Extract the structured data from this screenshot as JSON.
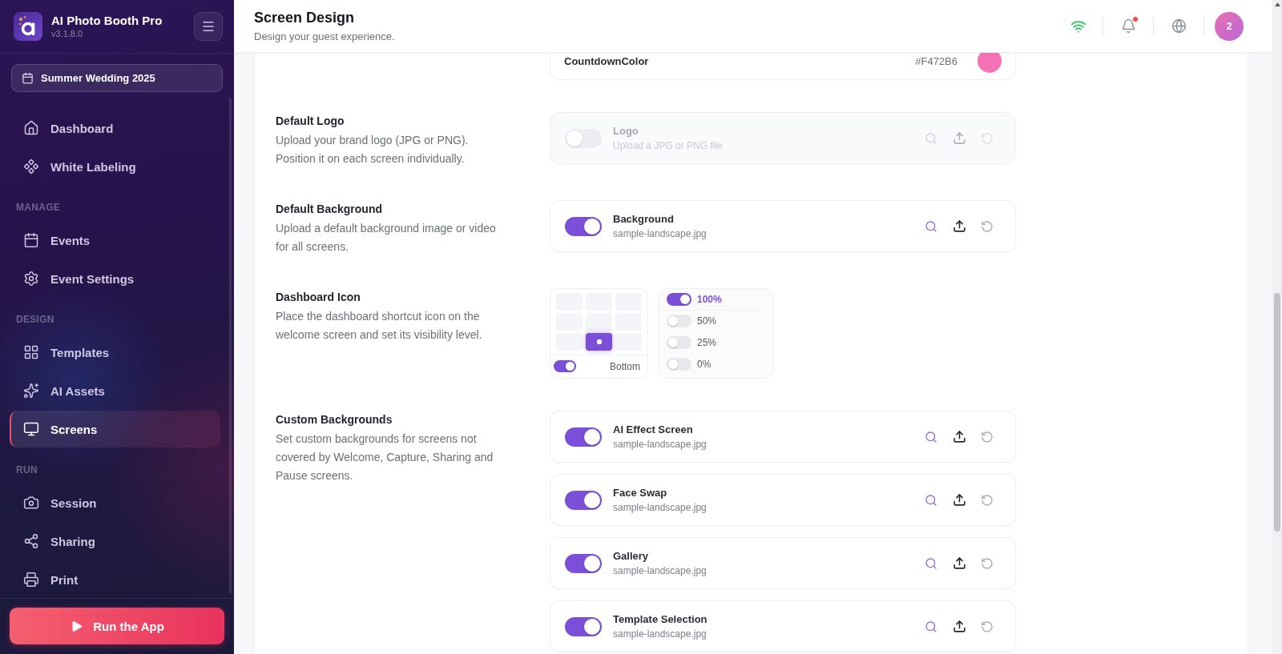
{
  "sidebar": {
    "app_name": "AI Photo Booth Pro",
    "version": "v3.1.8.0",
    "event": "Summer Wedding 2025",
    "nav_groups": [
      {
        "items": [
          {
            "label": "Dashboard",
            "selected": false
          },
          {
            "label": "White Labeling",
            "selected": false
          }
        ]
      },
      {
        "heading": "MANAGE",
        "items": [
          {
            "label": "Events",
            "selected": false
          },
          {
            "label": "Event Settings",
            "selected": false
          }
        ]
      },
      {
        "heading": "DESIGN",
        "items": [
          {
            "label": "Templates",
            "selected": false
          },
          {
            "label": "AI Assets",
            "selected": false
          },
          {
            "label": "Screens",
            "selected": true
          }
        ]
      },
      {
        "heading": "RUN",
        "items": [
          {
            "label": "Session",
            "selected": false
          },
          {
            "label": "Sharing",
            "selected": false
          },
          {
            "label": "Print",
            "selected": false
          }
        ]
      }
    ],
    "run_button": "Run the App"
  },
  "header": {
    "title": "Screen Design",
    "subtitle": "Design your guest experience.",
    "has_notification": true,
    "avatar": "2"
  },
  "countdown_color": {
    "label": "CountdownColor",
    "value": "#F472B6",
    "color": "#f472b6"
  },
  "sections": [
    {
      "kind": "uploads",
      "title": "Default Logo",
      "description": "Upload your brand logo (JPG or PNG). Position it on each screen individually.",
      "items": [
        {
          "name": "Logo",
          "detail": "Upload a JPG or PNG file",
          "on": false
        }
      ]
    },
    {
      "kind": "uploads",
      "title": "Default Background",
      "description": "Upload a default background image or video for all screens.",
      "items": [
        {
          "name": "Background",
          "detail": "sample-landscape.jpg",
          "on": true
        }
      ]
    },
    {
      "kind": "dashboard_icon",
      "title": "Dashboard Icon",
      "description": "Place the dashboard shortcut icon on the welcome screen and set its visibility level.",
      "position": {
        "cells": [
          {
            "selected": false
          },
          {
            "selected": false
          },
          {
            "selected": false
          },
          {
            "selected": false
          },
          {
            "selected": false
          },
          {
            "selected": false
          },
          {
            "selected": false
          },
          {
            "selected": true
          },
          {
            "selected": false
          }
        ],
        "label": "Bottom",
        "on": true
      },
      "visibility": [
        {
          "label": "100%",
          "selected": true
        },
        {
          "label": "50%",
          "selected": false
        },
        {
          "label": "25%",
          "selected": false
        },
        {
          "label": "0%",
          "selected": false
        }
      ]
    },
    {
      "kind": "uploads",
      "title": "Custom Backgrounds",
      "description": "Set custom backgrounds for screens not covered by Welcome, Capture, Sharing and Pause screens.",
      "items": [
        {
          "name": "AI Effect Screen",
          "detail": "sample-landscape.jpg",
          "on": true
        },
        {
          "name": "Face Swap",
          "detail": "sample-landscape.jpg",
          "on": true
        },
        {
          "name": "Gallery",
          "detail": "sample-landscape.jpg",
          "on": true
        },
        {
          "name": "Template Selection",
          "detail": "sample-landscape.jpg",
          "on": true
        }
      ]
    }
  ]
}
